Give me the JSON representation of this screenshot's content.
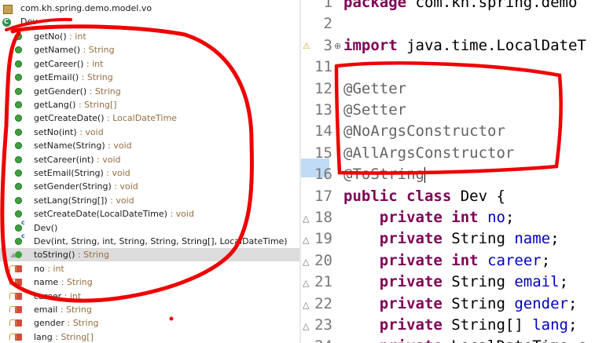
{
  "outline": {
    "package": "com.kh.spring.demo.model.vo",
    "class_name": "Dev",
    "members": [
      {
        "kind": "method",
        "name": "getNo()",
        "type": " : int"
      },
      {
        "kind": "method",
        "name": "getName()",
        "type": " : String"
      },
      {
        "kind": "method",
        "name": "getCareer()",
        "type": " : int"
      },
      {
        "kind": "method",
        "name": "getEmail()",
        "type": " : String"
      },
      {
        "kind": "method",
        "name": "getGender()",
        "type": " : String"
      },
      {
        "kind": "method",
        "name": "getLang()",
        "type": " : String[]"
      },
      {
        "kind": "method",
        "name": "getCreateDate()",
        "type": " : LocalDateTime"
      },
      {
        "kind": "method",
        "name": "setNo(int)",
        "type": " : void"
      },
      {
        "kind": "method",
        "name": "setName(String)",
        "type": " : void"
      },
      {
        "kind": "method",
        "name": "setCareer(int)",
        "type": " : void"
      },
      {
        "kind": "method",
        "name": "setEmail(String)",
        "type": " : void"
      },
      {
        "kind": "method",
        "name": "setGender(String)",
        "type": " : void"
      },
      {
        "kind": "method",
        "name": "setLang(String[])",
        "type": " : void"
      },
      {
        "kind": "method",
        "name": "setCreateDate(LocalDateTime)",
        "type": " : void"
      },
      {
        "kind": "ctor",
        "name": "Dev()",
        "type": ""
      },
      {
        "kind": "ctor",
        "name": "Dev(int, String, int, String, String, String[], LocalDateTime)",
        "type": ""
      },
      {
        "kind": "override",
        "name": "toString()",
        "type": " : String"
      },
      {
        "kind": "field",
        "name": "no",
        "type": " : int"
      },
      {
        "kind": "field",
        "name": "name",
        "type": " : String"
      },
      {
        "kind": "field",
        "name": "career",
        "type": " : int"
      },
      {
        "kind": "field",
        "name": "email",
        "type": " : String"
      },
      {
        "kind": "field",
        "name": "gender",
        "type": " : String"
      },
      {
        "kind": "field",
        "name": "lang",
        "type": " : String[]"
      }
    ]
  },
  "editor": {
    "lines": [
      {
        "num": "1",
        "parts": [
          {
            "c": "kw",
            "t": "package"
          },
          {
            "c": "",
            "t": " com.kh.spring.demo"
          }
        ]
      },
      {
        "num": "2",
        "parts": []
      },
      {
        "num": "3",
        "parts": [
          {
            "c": "kw",
            "t": "import"
          },
          {
            "c": "",
            "t": " java.time.LocalDateT"
          }
        ]
      },
      {
        "num": "11",
        "parts": []
      },
      {
        "num": "12",
        "parts": [
          {
            "c": "ann",
            "t": "@Getter"
          }
        ]
      },
      {
        "num": "13",
        "parts": [
          {
            "c": "ann",
            "t": "@Setter"
          }
        ]
      },
      {
        "num": "14",
        "parts": [
          {
            "c": "ann",
            "t": "@NoArgsConstructor"
          }
        ]
      },
      {
        "num": "15",
        "parts": [
          {
            "c": "ann",
            "t": "@AllArgsConstructor"
          }
        ]
      },
      {
        "num": "16",
        "parts": [
          {
            "c": "ann",
            "t": "@ToString"
          }
        ]
      },
      {
        "num": "17",
        "parts": [
          {
            "c": "kw",
            "t": "public class"
          },
          {
            "c": "",
            "t": " Dev {"
          }
        ]
      },
      {
        "num": "18",
        "parts": [
          {
            "c": "",
            "t": "    "
          },
          {
            "c": "kw",
            "t": "private int"
          },
          {
            "c": "",
            "t": " "
          },
          {
            "c": "fld",
            "t": "no"
          },
          {
            "c": "",
            "t": ";"
          }
        ]
      },
      {
        "num": "19",
        "parts": [
          {
            "c": "",
            "t": "    "
          },
          {
            "c": "kw",
            "t": "private"
          },
          {
            "c": "",
            "t": " String "
          },
          {
            "c": "fld",
            "t": "name"
          },
          {
            "c": "",
            "t": ";"
          }
        ]
      },
      {
        "num": "20",
        "parts": [
          {
            "c": "",
            "t": "    "
          },
          {
            "c": "kw",
            "t": "private int"
          },
          {
            "c": "",
            "t": " "
          },
          {
            "c": "fld",
            "t": "career"
          },
          {
            "c": "",
            "t": ";"
          }
        ]
      },
      {
        "num": "21",
        "parts": [
          {
            "c": "",
            "t": "    "
          },
          {
            "c": "kw",
            "t": "private"
          },
          {
            "c": "",
            "t": " String "
          },
          {
            "c": "fld",
            "t": "email"
          },
          {
            "c": "",
            "t": ";"
          }
        ]
      },
      {
        "num": "22",
        "parts": [
          {
            "c": "",
            "t": "    "
          },
          {
            "c": "kw",
            "t": "private"
          },
          {
            "c": "",
            "t": " String "
          },
          {
            "c": "fld",
            "t": "gender"
          },
          {
            "c": "",
            "t": ";"
          }
        ]
      },
      {
        "num": "23",
        "parts": [
          {
            "c": "",
            "t": "    "
          },
          {
            "c": "kw",
            "t": "private"
          },
          {
            "c": "",
            "t": " String[] "
          },
          {
            "c": "fld",
            "t": "lang"
          },
          {
            "c": "",
            "t": ";"
          }
        ]
      },
      {
        "num": "24",
        "parts": [
          {
            "c": "",
            "t": "    "
          },
          {
            "c": "kw",
            "t": "private"
          },
          {
            "c": "",
            "t": " LocalDateTime c"
          }
        ]
      }
    ]
  },
  "colors": {
    "keyword": "#7f0055",
    "field": "#0000c0",
    "annotation": "#646464",
    "type_hint": "#946f40",
    "marker": "#ee0000"
  }
}
